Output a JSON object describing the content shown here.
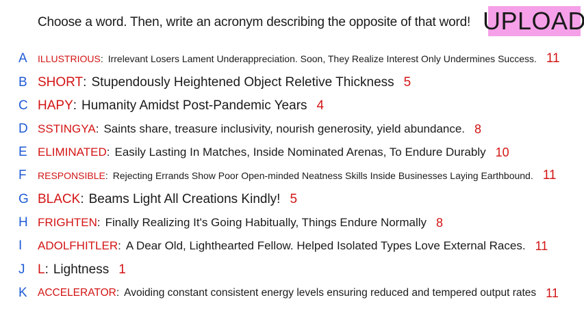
{
  "prompt": "Choose a word. Then, write an acronym describing the opposite of that word!",
  "upload_label": "UPLOAD",
  "rows": [
    {
      "letter": "A",
      "word": "ILLUSTRIOUS",
      "acronym": "Irrelevant Losers Lament Underappreciation. Soon, They Realize Interest Only Undermines Success.",
      "count": "11"
    },
    {
      "letter": "B",
      "word": "SHORT",
      "acronym": "Stupendously Heightened Object Reletive Thickness",
      "count": "5"
    },
    {
      "letter": "C",
      "word": "HAPY",
      "acronym": "Humanity Amidst Post-Pandemic Years",
      "count": "4"
    },
    {
      "letter": "D",
      "word": "SSTINGYA",
      "acronym": "Saints share, treasure inclusivity, nourish generosity, yield abundance.",
      "count": "8"
    },
    {
      "letter": "E",
      "word": "ELIMINATED",
      "acronym": "Easily Lasting In Matches, Inside Nominated Arenas, To Endure Durably",
      "count": "10"
    },
    {
      "letter": "F",
      "word": "RESPONSIBLE",
      "acronym": "Rejecting Errands Show Poor Open-minded Neatness Skills Inside Businesses Laying Earthbound.",
      "count": "11"
    },
    {
      "letter": "G",
      "word": "BLACK",
      "acronym": "Beams Light All Creations Kindly!",
      "count": "5"
    },
    {
      "letter": "H",
      "word": "FRIGHTEN",
      "acronym": "Finally Realizing It's Going Habitually, Things Endure Normally",
      "count": "8"
    },
    {
      "letter": "I",
      "word": "ADOLFHITLER",
      "acronym": "A Dear Old, Lighthearted Fellow. Helped Isolated Types Love External Races.",
      "count": "11"
    },
    {
      "letter": "J",
      "word": "L",
      "acronym": "Lightness",
      "count": "1"
    },
    {
      "letter": "K",
      "word": "ACCELERATOR",
      "acronym": "Avoiding constant consistent energy levels ensuring reduced and tempered output rates",
      "count": "11"
    }
  ]
}
